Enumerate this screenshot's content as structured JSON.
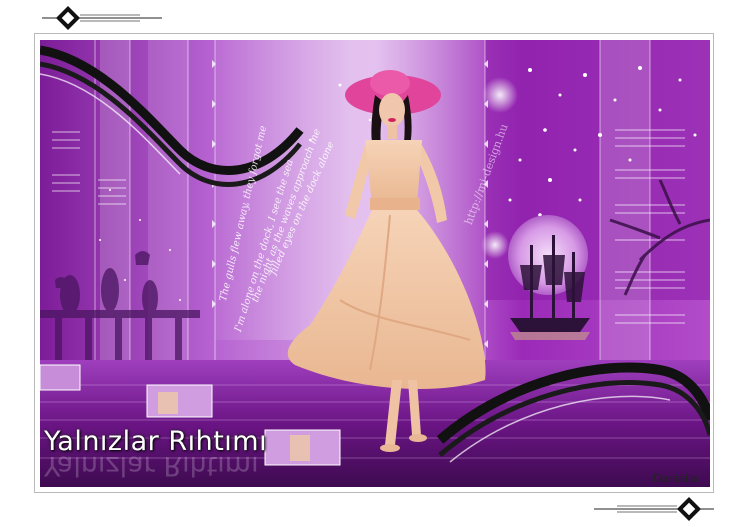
{
  "title": "Yalnızlar Rıhtımı",
  "signature": "Daniella",
  "watermark": "http://mi-design.hu",
  "poem_lines": [
    "The gulls flew away, they forgot me",
    "I'm alone on the dock, I see the sea",
    "the night as the waves approach me",
    "filled eyes on the dock alone"
  ],
  "colors": {
    "primary_purple": "#8a1fa3",
    "light_purple": "#c76ee0",
    "dark_purple": "#3b0a4a",
    "hat": "#e0459b",
    "dress": "#f2c9a8"
  }
}
